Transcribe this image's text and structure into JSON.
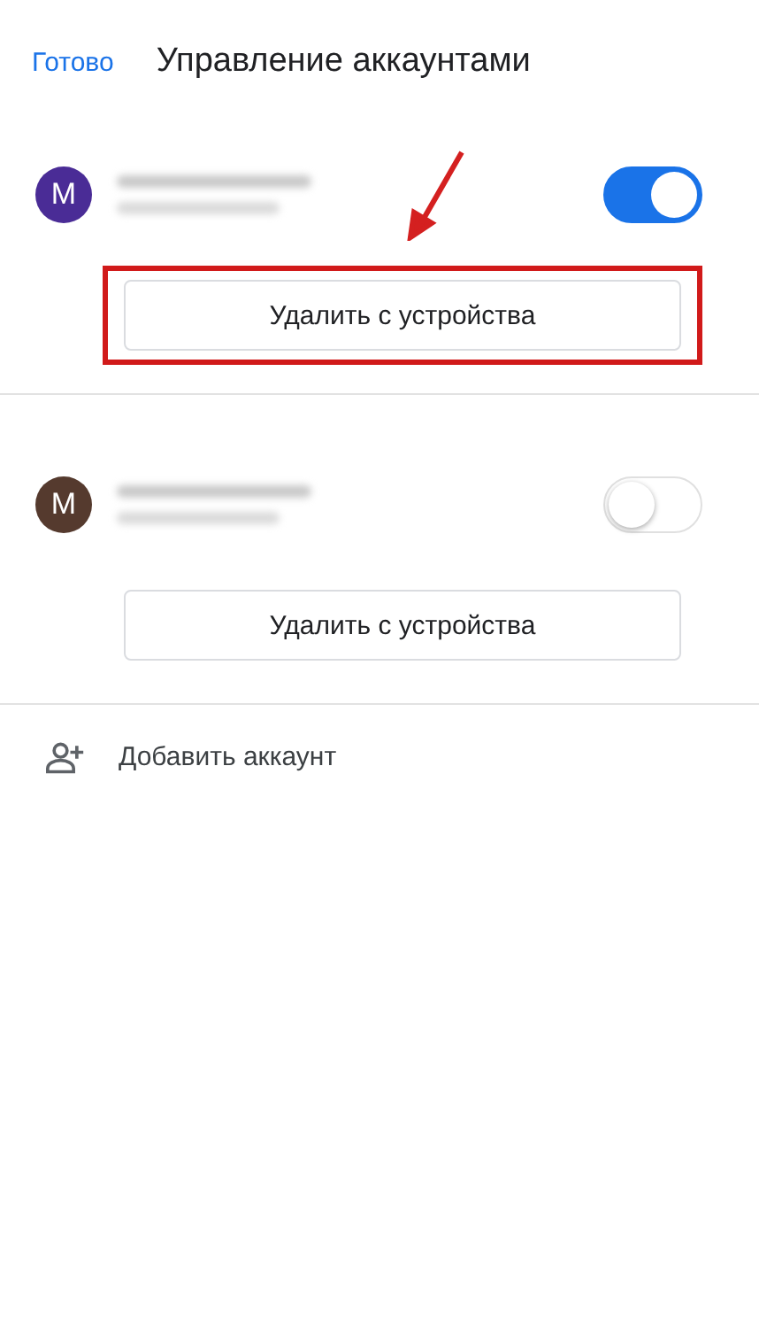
{
  "header": {
    "done": "Готово",
    "title": "Управление аккаунтами"
  },
  "accounts": [
    {
      "avatar_letter": "M",
      "color": "#4a2c96",
      "on": true,
      "highlighted": true,
      "remove_button": "Удалить с устройства"
    },
    {
      "avatar_letter": "M",
      "color": "#553a2e",
      "on": false,
      "highlighted": false,
      "remove_button": "Удалить с устройства"
    }
  ],
  "add_account": "Добавить аккаунт"
}
